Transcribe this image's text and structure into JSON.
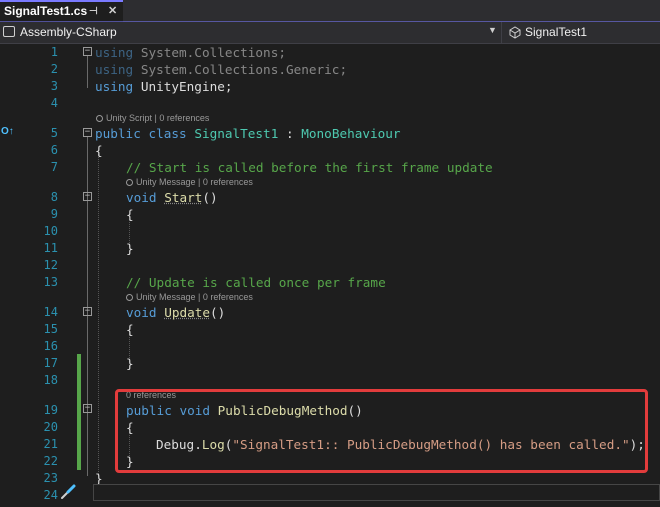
{
  "tab": {
    "title": "SignalTest1.cs",
    "pin_glyph": "⊣",
    "close_glyph": "✕"
  },
  "navbar": {
    "project": "Assembly-CSharp",
    "class": "SignalTest1"
  },
  "editor": {
    "line_numbers": [
      "1",
      "2",
      "3",
      "4",
      "5",
      "6",
      "7",
      "8",
      "9",
      "10",
      "11",
      "12",
      "13",
      "14",
      "15",
      "16",
      "17",
      "18",
      "19",
      "20",
      "21",
      "22",
      "23",
      "24"
    ],
    "code": {
      "l1_kw": "using",
      "l1_rest": " System.Collections;",
      "l2_kw": "using",
      "l2_rest": " System.Collections.Generic;",
      "l3_kw": "using",
      "l3_rest": " UnityEngine;",
      "l5_kw": "public class",
      "l5_name": "SignalTest1",
      "l5_sep": " : ",
      "l5_base": "MonoBehaviour",
      "l6": "{",
      "l7": "// Start is called before the first frame update",
      "l8_kw": "void",
      "l8_fn": "Start",
      "l8_rest": "()",
      "l9": "{",
      "l11": "}",
      "l13": "// Update is called once per frame",
      "l14_kw": "void",
      "l14_fn": "Update",
      "l14_rest": "()",
      "l15": "{",
      "l17": "}",
      "l19_kw": "public void",
      "l19_fn": "PublicDebugMethod",
      "l19_rest": "()",
      "l20": "{",
      "l21_a": "Debug.",
      "l21_fn": "Log",
      "l21_b": "(",
      "l21_str": "\"SignalTest1:: PublicDebugMethod() has been called.\"",
      "l21_c": ");",
      "l22": "}",
      "l23": "}"
    },
    "codelens": {
      "class": "Unity Script | 0 references",
      "start": "Unity Message | 0 references",
      "update": "Unity Message | 0 references",
      "public_method": "0 references"
    }
  },
  "colors": {
    "keyword": "#569cd6",
    "type": "#4ec9b0",
    "method": "#dcdcaa",
    "string": "#d69d85",
    "comment": "#57a64a",
    "line_number": "#2b91af",
    "highlight_box": "#e23c3c"
  }
}
